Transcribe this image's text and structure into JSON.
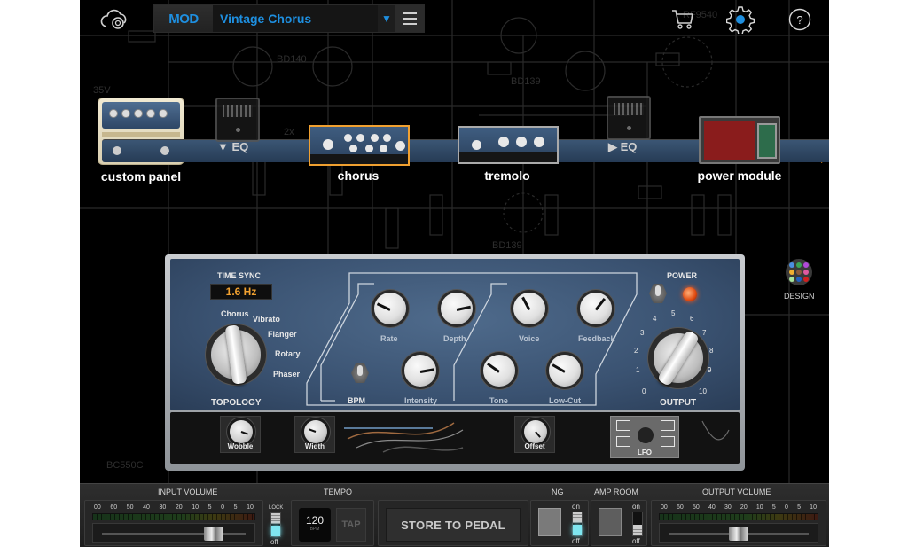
{
  "header": {
    "brand": "MOD",
    "preset_name": "Vintage Chorus",
    "icons": [
      "cloud-icon",
      "caret-down-icon",
      "menu-icon",
      "cart-icon",
      "gear-icon",
      "help-icon"
    ],
    "help_glyph": "?",
    "accent_color": "#1e8fe0"
  },
  "chain": {
    "items": [
      {
        "id": "custom-panel",
        "label": "custom panel"
      },
      {
        "id": "eq-pre",
        "label": "▼ EQ"
      },
      {
        "id": "chorus",
        "label": "chorus",
        "selected": true
      },
      {
        "id": "tremolo",
        "label": "tremolo"
      },
      {
        "id": "eq-post",
        "label": "▶ EQ"
      },
      {
        "id": "power-module",
        "label": "power module"
      }
    ],
    "signal_color": "#e08a25"
  },
  "design": {
    "label": "DESIGN"
  },
  "rack": {
    "time_sync_label": "TIME SYNC",
    "time_sync_value": "1.6 Hz",
    "topology": {
      "label": "TOPOLOGY",
      "options": [
        "Chorus",
        "Vibrato",
        "Flanger",
        "Rotary",
        "Phaser"
      ],
      "selected": "Chorus"
    },
    "knobs": [
      {
        "id": "rate",
        "label": "Rate",
        "value": 2
      },
      {
        "id": "depth",
        "label": "Depth",
        "value": 8
      },
      {
        "id": "intensity",
        "label": "Intensity",
        "value": 8
      },
      {
        "id": "voice",
        "label": "Voice",
        "value": 2
      },
      {
        "id": "feedback",
        "label": "Feedback",
        "value": 7
      },
      {
        "id": "tone",
        "label": "Tone",
        "value": 3
      },
      {
        "id": "low-cut",
        "label": "Low-Cut",
        "value": 2.5
      }
    ],
    "bpm_label": "BPM",
    "power_label": "POWER",
    "output": {
      "label": "OUTPUT",
      "value": 6,
      "scale": [
        "0",
        "1",
        "2",
        "3",
        "4",
        "5",
        "6",
        "7",
        "8",
        "9",
        "10"
      ]
    },
    "lower": {
      "wobble": "Wobble",
      "width": "Width",
      "offset": "Offset",
      "lfo": "LFO"
    }
  },
  "bottom": {
    "input_volume": {
      "title": "INPUT VOLUME",
      "scale": [
        "00",
        "60",
        "50",
        "40",
        "30",
        "20",
        "10",
        "5",
        "0",
        "5",
        "10"
      ],
      "level": 0.78
    },
    "lock": {
      "label": "LOCK",
      "state": "off"
    },
    "tempo": {
      "title": "TEMPO",
      "bpm": "120",
      "bpm_unit": "BPM",
      "tap_label": "TAP"
    },
    "store_label": "STORE TO PEDAL",
    "ng": {
      "title": "NG",
      "on_label": "on",
      "off_label": "off",
      "state": "off"
    },
    "amp_room": {
      "title": "AMP ROOM",
      "on_label": "on",
      "off_label": "off",
      "state": "off"
    },
    "output_volume": {
      "title": "OUTPUT VOLUME",
      "scale": [
        "00",
        "60",
        "50",
        "40",
        "30",
        "20",
        "10",
        "5",
        "0",
        "5",
        "10"
      ],
      "level": 0.5
    }
  }
}
